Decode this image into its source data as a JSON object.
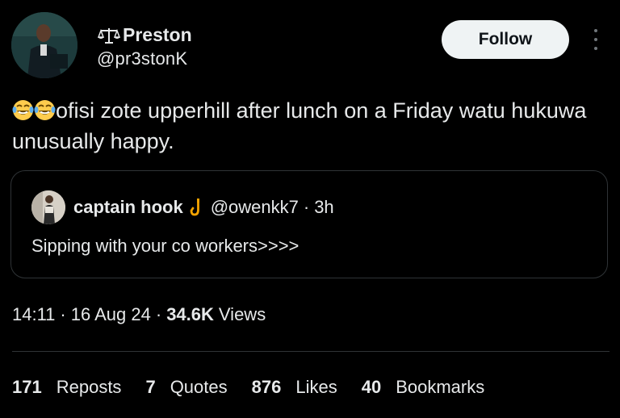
{
  "author": {
    "display_name": "Preston",
    "handle": "@pr3stonK",
    "avatar_icon": "profile-photo"
  },
  "follow_label": "Follow",
  "tweet": {
    "text": "ofisi zote upperhill after lunch on a Friday watu hukuwa unusually happy.",
    "leading_emojis": "😂😂"
  },
  "quote": {
    "name": "captain hook",
    "name_emoji_icon": "hook-icon",
    "handle": "@owenkk7",
    "time": "3h",
    "text": "Sipping with your co workers>>>>"
  },
  "meta": {
    "time": "14:11",
    "date": "16 Aug 24",
    "views_count": "34.6K",
    "views_label": "Views"
  },
  "stats": [
    {
      "count": "171",
      "label": "Reposts"
    },
    {
      "count": "7",
      "label": "Quotes"
    },
    {
      "count": "876",
      "label": "Likes"
    },
    {
      "count": "40",
      "label": "Bookmarks"
    }
  ],
  "colors": {
    "background": "#000000",
    "text": "#e7e9ea",
    "border": "#2f3336",
    "follow_bg": "#eff3f4"
  }
}
